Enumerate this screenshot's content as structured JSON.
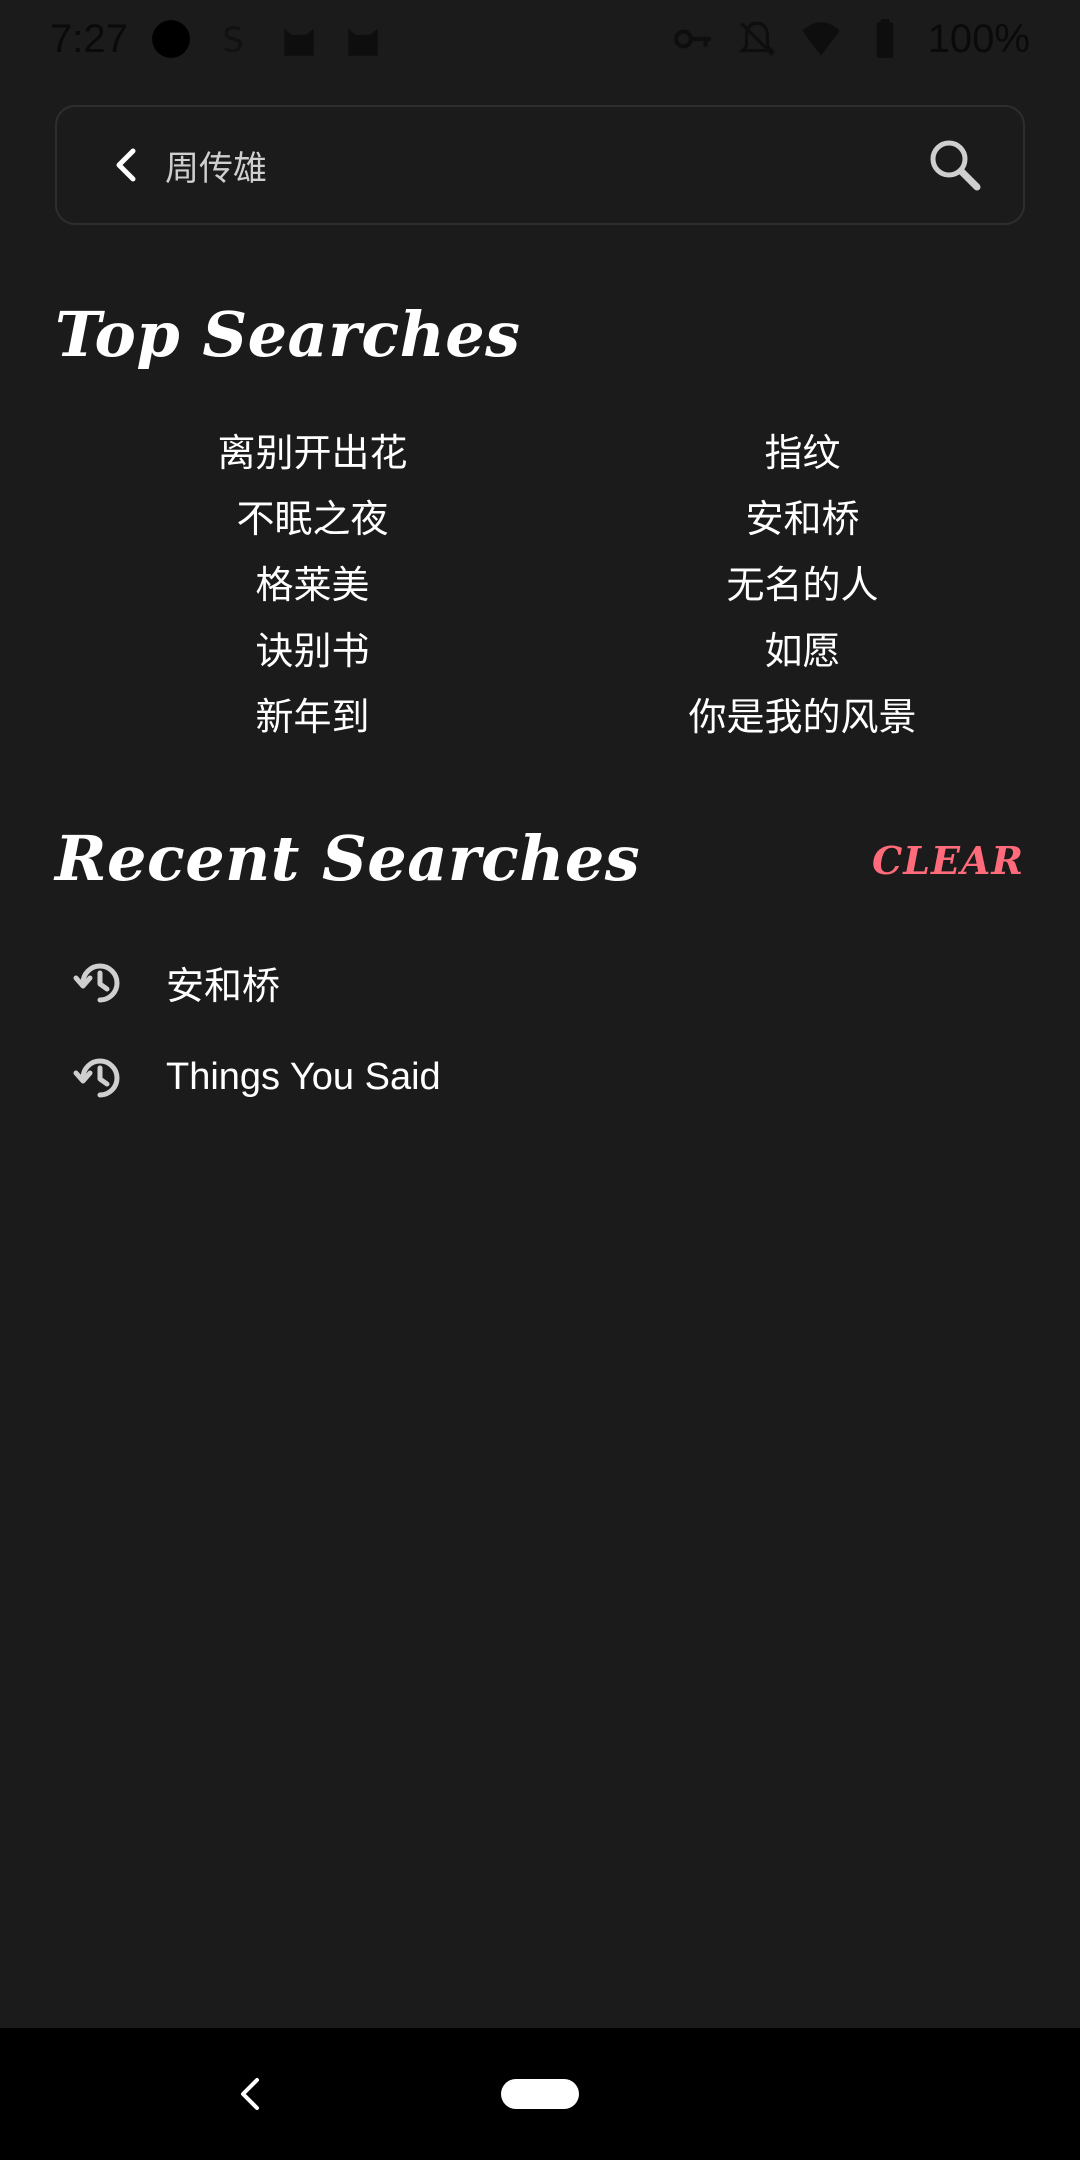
{
  "status_bar": {
    "time": "7:27",
    "battery": "100%"
  },
  "search": {
    "placeholder": "",
    "value": "周传雄"
  },
  "top_searches": {
    "title": "Top Searches",
    "left": [
      "离别开出花",
      "不眠之夜",
      "格莱美",
      "诀别书",
      "新年到"
    ],
    "right": [
      "指纹",
      "安和桥",
      "无名的人",
      "如愿",
      "你是我的风景"
    ]
  },
  "recent_searches": {
    "title": "Recent Searches",
    "clear_label": "CLEAR",
    "items": [
      "安和桥",
      "Things You Said"
    ]
  },
  "colors": {
    "background": "#1b1b1b",
    "accent": "#ff6b7a",
    "nav_bar": "#000000"
  }
}
